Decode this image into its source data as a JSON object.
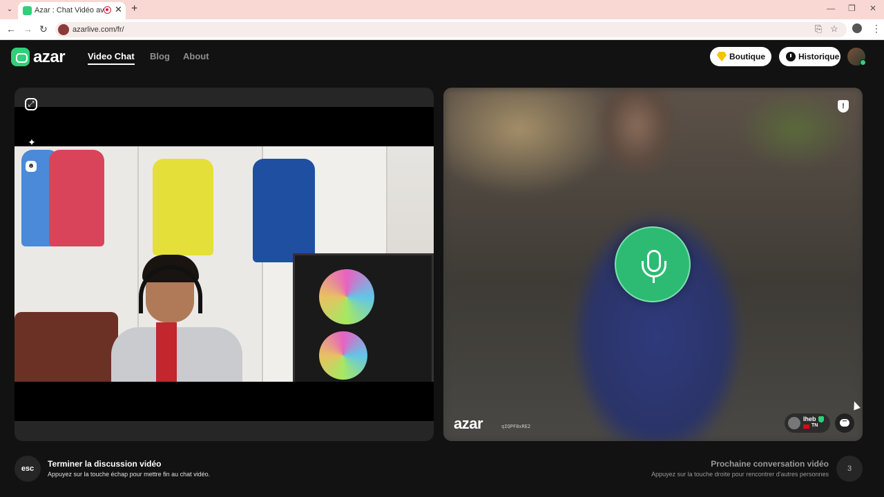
{
  "browser": {
    "tab_title": "Azar : Chat Vidéo avec de n",
    "tab_close": "✕",
    "new_tab": "+",
    "url": "azarlive.com/fr/",
    "back_icon": "←",
    "forward_icon": "→",
    "reload_icon": "↻",
    "minimize_icon": "—",
    "restore_icon": "❐",
    "close_window_icon": "✕",
    "install_icon": "⎘",
    "bookmark_icon": "☆",
    "menu_icon": "⋮",
    "tab_menu_icon": "⌄"
  },
  "header": {
    "logo_text": "azar",
    "nav": [
      "Video Chat",
      "Blog",
      "About"
    ],
    "active_nav": "Video Chat",
    "shop_label": "Boutique",
    "history_label": "Historique"
  },
  "left_panel": {
    "expand_icon": "⤢",
    "wand_icon": "✦",
    "face_icon": "☻"
  },
  "right_panel": {
    "report_icon": "!",
    "watermark": "azar",
    "watermark_id": "qIQPF8xRE2",
    "user_name": "Iheb",
    "user_country": "TN",
    "chat_icon": "•••"
  },
  "footer": {
    "esc_key": "esc",
    "end_title": "Terminer la discussion vidéo",
    "end_sub": "Appuyez sur la touche échap pour mettre fin au chat vidéo.",
    "next_title": "Prochaine conversation vidéo",
    "next_sub": "Appuyez sur la touche droite pour rencontrer d'autres personnes",
    "next_key": "3"
  },
  "colors": {
    "accent_green": "#2fd07a",
    "mic_green": "#2dbb74",
    "background": "#121212",
    "panel": "#262626"
  }
}
